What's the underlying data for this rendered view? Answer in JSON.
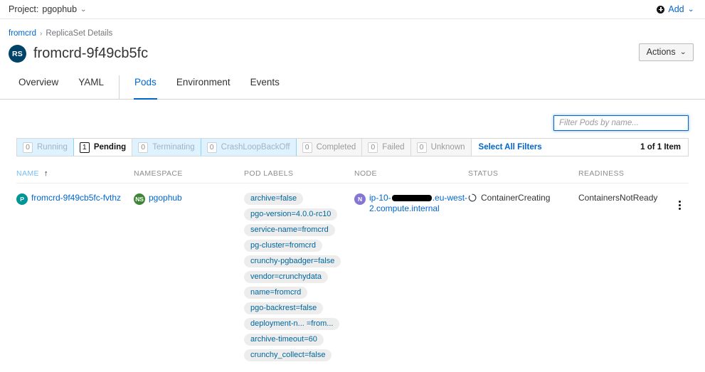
{
  "topbar": {
    "project_label": "Project:",
    "project_name": "pgophub",
    "caret": "⌄",
    "add_label": "Add",
    "add_icon": "plus-circle-icon"
  },
  "breadcrumb": {
    "parent": "fromcrd",
    "separator": "›",
    "current": "ReplicaSet Details"
  },
  "header": {
    "badge": "RS",
    "title": "fromcrd-9f49cb5fc",
    "actions_label": "Actions"
  },
  "tabs": [
    {
      "label": "Overview",
      "selected": false
    },
    {
      "label": "YAML",
      "selected": false
    },
    {
      "label": "Pods",
      "selected": true
    },
    {
      "label": "Environment",
      "selected": false
    },
    {
      "label": "Events",
      "selected": false
    }
  ],
  "toolbar": {
    "filter_placeholder": "Filter Pods by name...",
    "filter_value": ""
  },
  "status_filters": [
    {
      "count": "0",
      "label": "Running",
      "state": "blue"
    },
    {
      "count": "1",
      "label": "Pending",
      "state": "active"
    },
    {
      "count": "0",
      "label": "Terminating",
      "state": "blue"
    },
    {
      "count": "0",
      "label": "CrashLoopBackOff",
      "state": "blue"
    },
    {
      "count": "0",
      "label": "Completed",
      "state": "gray"
    },
    {
      "count": "0",
      "label": "Failed",
      "state": "gray"
    },
    {
      "count": "0",
      "label": "Unknown",
      "state": "gray"
    }
  ],
  "select_all_filters": "Select All Filters",
  "item_count": "1 of 1 Item",
  "table": {
    "columns": [
      {
        "label": "NAME",
        "sorted": true,
        "sort_arrow": "↑"
      },
      {
        "label": "NAMESPACE",
        "sorted": false
      },
      {
        "label": "POD LABELS",
        "sorted": false
      },
      {
        "label": "NODE",
        "sorted": false
      },
      {
        "label": "STATUS",
        "sorted": false
      },
      {
        "label": "READINESS",
        "sorted": false
      }
    ],
    "row": {
      "name_badge": "P",
      "name": "fromcrd-9f49cb5fc-fvthz",
      "namespace_badge": "NS",
      "namespace": "pgophub",
      "labels": [
        "archive=false",
        "pgo-version=4.0.0-rc10",
        "service-name=fromcrd",
        "pg-cluster=fromcrd",
        "crunchy-pgbadger=false",
        "vendor=crunchydata",
        "name=fromcrd",
        "pgo-backrest=false",
        "deployment-n... =from...",
        "archive-timeout=60",
        "crunchy_collect=false"
      ],
      "node_badge": "N",
      "node_prefix": "ip-10-",
      "node_suffix": ".eu-west-2.compute.internal",
      "status": "ContainerCreating",
      "status_icon": "spinner-icon",
      "readiness": "ContainersNotReady",
      "kebab_icon": "kebab-menu-icon"
    }
  },
  "colors": {
    "link": "#0066cc",
    "badge_replicaset": "#004368",
    "badge_pod": "#009596",
    "badge_namespace": "#3e8635",
    "badge_node": "#8476d1",
    "filter_selected_bg": "#def3ff"
  }
}
